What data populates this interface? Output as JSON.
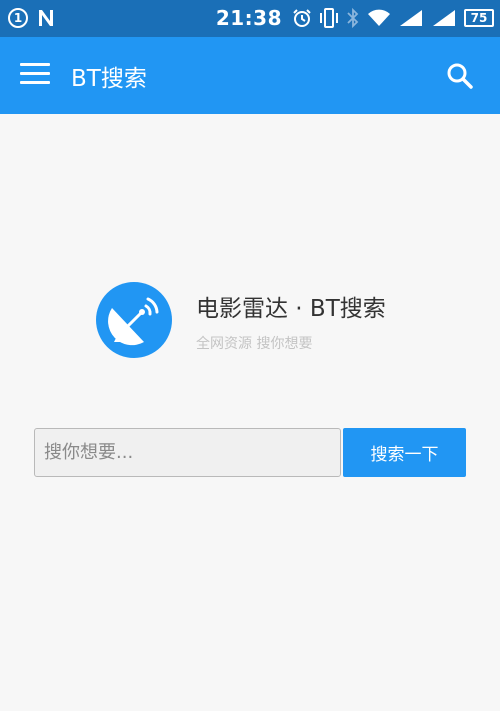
{
  "status_bar": {
    "notification_count": "1",
    "time": "21:38",
    "battery": "75",
    "icons": [
      "notification-count-icon",
      "n-icon",
      "alarm-icon",
      "vibrate-icon",
      "bluetooth-icon",
      "wifi-icon",
      "signal-icon",
      "signal-icon-2",
      "battery-icon"
    ]
  },
  "appbar": {
    "title": "BT搜索",
    "menu_icon": "hamburger-menu-icon",
    "search_icon": "search-icon",
    "color": "#2196f3"
  },
  "brand": {
    "title": "电影雷达 · BT搜索",
    "subtitle": "全网资源 搜你想要",
    "logo_icon": "satellite-dish-icon"
  },
  "search": {
    "placeholder": "搜你想要...",
    "value": "",
    "button_label": "搜索一下"
  },
  "colors": {
    "status_bar": "#1a6fb7",
    "accent": "#2196f3",
    "background": "#f7f7f7"
  }
}
